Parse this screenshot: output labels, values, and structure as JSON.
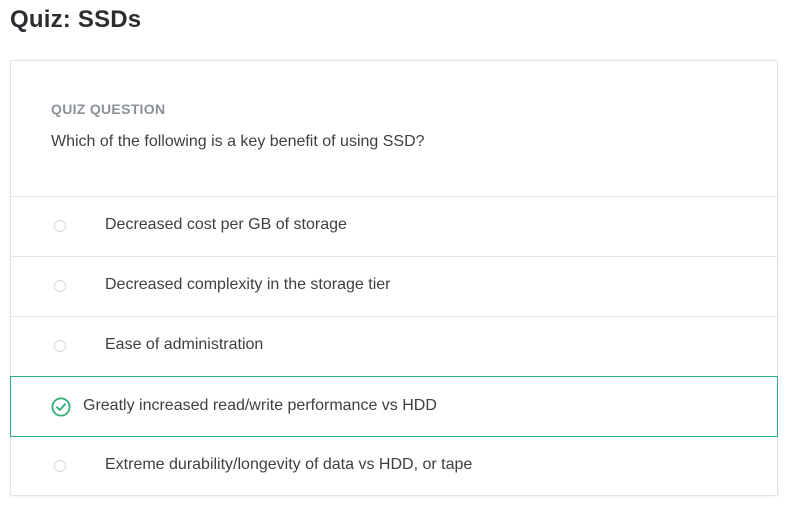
{
  "page": {
    "title": "Quiz: SSDs"
  },
  "quiz": {
    "eyebrow": "QUIZ QUESTION",
    "question": "Which of the following is a key benefit of using SSD?",
    "options": [
      {
        "label": "Decreased cost per GB of storage",
        "state": "unselected"
      },
      {
        "label": "Decreased complexity in the storage tier",
        "state": "unselected"
      },
      {
        "label": "Ease of administration",
        "state": "unselected"
      },
      {
        "label": "Greatly increased read/write performance vs HDD",
        "state": "correct"
      },
      {
        "label": "Extreme durability/longevity of data vs HDD, or tape",
        "state": "unselected"
      }
    ]
  },
  "colors": {
    "correct_accent": "#2fae77",
    "eyebrow_text": "#8a9199",
    "body_text": "#3d3f43"
  },
  "icons": {
    "correct": "check-circle-icon",
    "unselected": "radio-circle-icon"
  }
}
